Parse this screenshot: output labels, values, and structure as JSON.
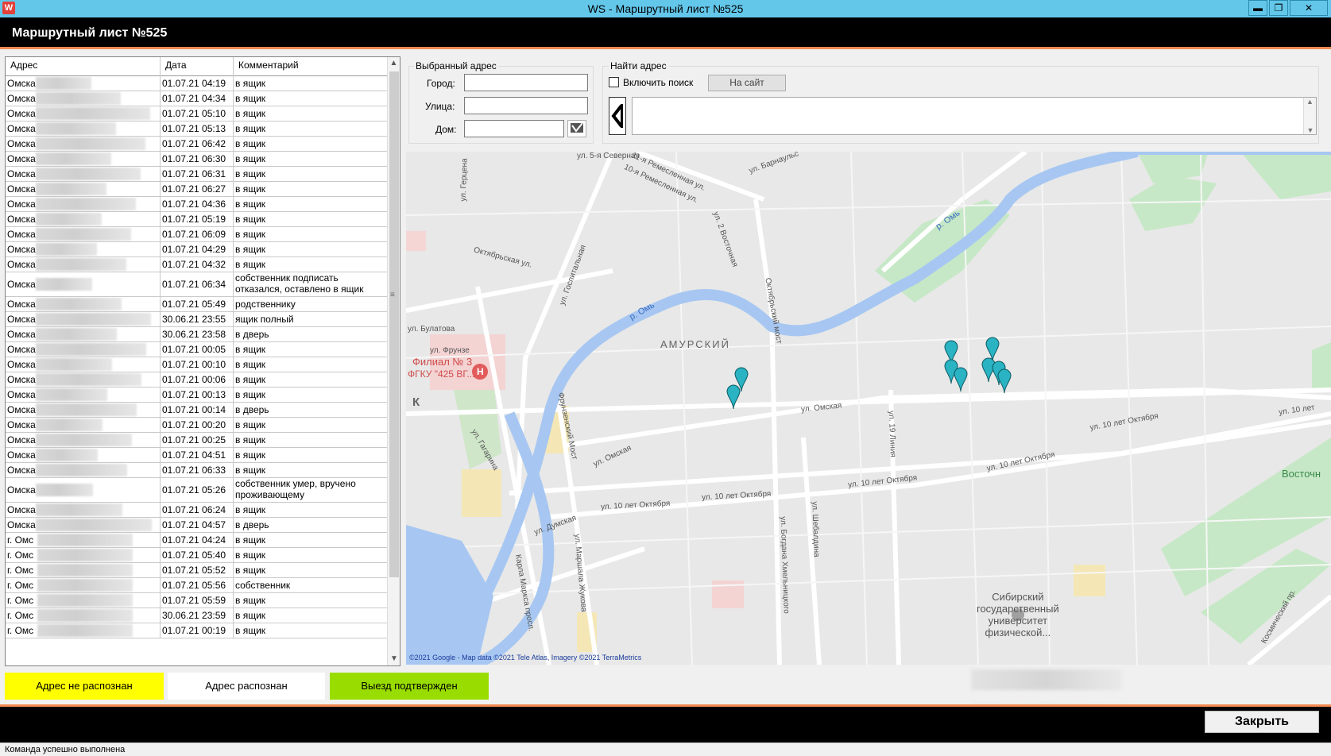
{
  "window": {
    "title": "WS - Маршрутный лист №525",
    "minimize": "▬",
    "restore": "❐",
    "close": "✕"
  },
  "header": {
    "title": "Маршрутный лист №525"
  },
  "table": {
    "columns": [
      "Адрес",
      "Дата",
      "Комментарий"
    ],
    "rows": [
      {
        "address": "Омска",
        "date": "01.07.21 04:19",
        "comment": "в ящик"
      },
      {
        "address": "Омска",
        "date": "01.07.21 04:34",
        "comment": "в ящик"
      },
      {
        "address": "Омска",
        "date": "01.07.21 05:10",
        "comment": "в ящик"
      },
      {
        "address": "Омска",
        "date": "01.07.21 05:13",
        "comment": "в ящик"
      },
      {
        "address": "Омска",
        "date": "01.07.21 06:42",
        "comment": "в ящик"
      },
      {
        "address": "Омска",
        "date": "01.07.21 06:30",
        "comment": "в ящик"
      },
      {
        "address": "Омска",
        "date": "01.07.21 06:31",
        "comment": "в ящик"
      },
      {
        "address": "Омска",
        "date": "01.07.21 06:27",
        "comment": "в ящик"
      },
      {
        "address": "Омска",
        "date": "01.07.21 04:36",
        "comment": "в ящик"
      },
      {
        "address": "Омска",
        "date": "01.07.21 05:19",
        "comment": "в ящик"
      },
      {
        "address": "Омска",
        "date": "01.07.21 06:09",
        "comment": "в ящик"
      },
      {
        "address": "Омска",
        "date": "01.07.21 04:29",
        "comment": "в ящик"
      },
      {
        "address": "Омска",
        "date": "01.07.21 04:32",
        "comment": "в ящик"
      },
      {
        "address": "Омска",
        "date": "01.07.21 06:34",
        "comment": "собственник подписать отказался, оставлено в ящик",
        "tall": true
      },
      {
        "address": "Омска",
        "date": "01.07.21 05:49",
        "comment": "родственнику"
      },
      {
        "address": "Омска",
        "date": "30.06.21 23:55",
        "comment": "ящик полный"
      },
      {
        "address": "Омска",
        "date": "30.06.21 23:58",
        "comment": "в дверь"
      },
      {
        "address": "Омска",
        "date": "01.07.21 00:05",
        "comment": "в ящик"
      },
      {
        "address": "Омска",
        "date": "01.07.21 00:10",
        "comment": "в ящик"
      },
      {
        "address": "Омска",
        "date": "01.07.21 00:06",
        "comment": "в ящик"
      },
      {
        "address": "Омска",
        "date": "01.07.21 00:13",
        "comment": "в ящик"
      },
      {
        "address": "Омска",
        "date": "01.07.21 00:14",
        "comment": "в дверь"
      },
      {
        "address": "Омска",
        "date": "01.07.21 00:20",
        "comment": "в ящик"
      },
      {
        "address": "Омска",
        "date": "01.07.21 00:25",
        "comment": "в ящик"
      },
      {
        "address": "Омска",
        "date": "01.07.21 04:51",
        "comment": "в ящик"
      },
      {
        "address": "Омска",
        "date": "01.07.21 06:33",
        "comment": "в ящик"
      },
      {
        "address": "Омска",
        "date": "01.07.21 05:26",
        "comment": "собственник умер, вручено проживающему",
        "tall": true
      },
      {
        "address": "Омска",
        "date": "01.07.21 06:24",
        "comment": "в ящик"
      },
      {
        "address": "Омска",
        "date": "01.07.21 04:57",
        "comment": "в дверь"
      },
      {
        "address": "г. Омс",
        "date": "01.07.21 04:24",
        "comment": "в ящик"
      },
      {
        "address": "г. Омс",
        "date": "01.07.21 05:40",
        "comment": "в ящик"
      },
      {
        "address": "г. Омс",
        "date": "01.07.21 05:52",
        "comment": "в ящик"
      },
      {
        "address": "г. Омс",
        "date": "01.07.21 05:56",
        "comment": "собственник"
      },
      {
        "address": "г. Омс",
        "date": "01.07.21 05:59",
        "comment": "в ящик"
      },
      {
        "address": "г. Омс",
        "date": "30.06.21 23:59",
        "comment": "в ящик"
      },
      {
        "address": "г. Омс",
        "date": "01.07.21 00:19",
        "comment": "в ящик"
      }
    ]
  },
  "legend": {
    "unrecognized": "Адрес не распознан",
    "recognized": "Адрес распознан",
    "confirmed": "Выезд подтвержден",
    "colors": {
      "unrecognized": "#ffff00",
      "recognized": "#ffffff",
      "confirmed": "#99dd00"
    }
  },
  "selected": {
    "group": "Выбранный адрес",
    "city_label": "Город:",
    "street_label": "Улица:",
    "house_label": "Дом:",
    "city": "",
    "street": "",
    "house": ""
  },
  "find": {
    "group": "Найти адрес",
    "checkbox": "Включить поиск",
    "site_button": "На сайт"
  },
  "map": {
    "labels": {
      "district": "АМУРСКИЙ",
      "river1": "р. Омь",
      "river2": "р. Омь",
      "hospital": "Филиал № 3",
      "hospital2": "ФГКУ \"425 ВГ...",
      "univ1": "Сибирский",
      "univ2": "государственный",
      "univ3": "университет",
      "univ4": "физической...",
      "east": "Восточн",
      "street_omskaya1": "ул. Омская",
      "street_omskaya2": "ул. Омская",
      "oct1": "ул. 10 лет Октября",
      "oct2": "ул. 10 лет Октября",
      "oct3": "ул. 10 лет Октября",
      "oct4": "ул. 10 лет Октября",
      "oct5": "ул. 10 лет Октября",
      "oct6": "ул. 10 лет",
      "bulatova": "ул. Булатова",
      "frunze": "ул. Фрунзе",
      "oktyabrskaya": "Октябрьская ул.",
      "gospitalnaya": "ул. Госпитальная",
      "gertsena": "ул. Герцена",
      "severnaya": "ул. 5-я Северная",
      "remesl1": "11-я Ремесленная ул.",
      "remesl2": "10-я Ремесленная ул.",
      "barnaulskaya": "ул. Барнаульс",
      "vostochnaya": "ул. 2 Восточная",
      "oktmost": "Октябрьский мост",
      "frunzemost": "Фрунзенский Мост",
      "gagarina": "ул. Гагарина",
      "dumskaya": "ул. Думская",
      "karlamarksa": "Карла Маркса просп.",
      "zhukova": "ул. Маршала Жукова",
      "khmelnitskogo": "ул. Богдана Хмельницкого",
      "shebaldina": "ул. Шебалдина",
      "liniya19": "ул. 19 Линия",
      "kosmicheskiy": "Космический пр.",
      "k": "К",
      "copyright": "©2021 Google - Map data ©2021 Tele Atlas, Imagery ©2021 TerraMetrics"
    }
  },
  "footer": {
    "close_button": "Закрыть"
  },
  "status": {
    "text": "Команда успешно выполнена"
  }
}
